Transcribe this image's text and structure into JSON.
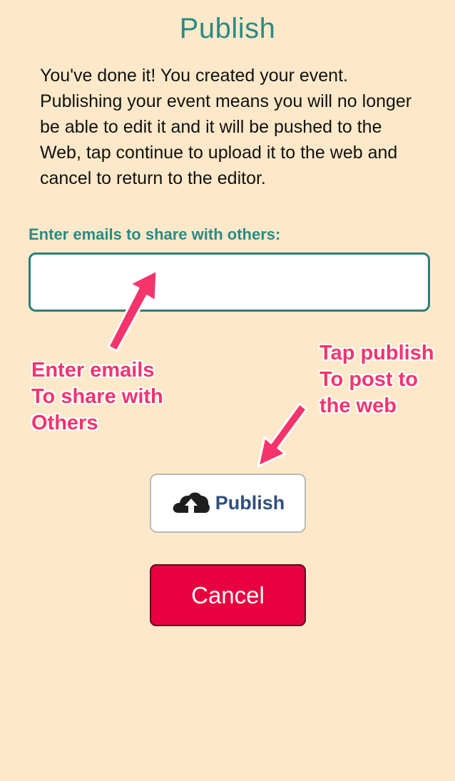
{
  "dialog": {
    "title": "Publish",
    "description": "You've done it! You created your event. Publishing your event means you will no longer be able to edit it and it will be pushed to the Web, tap continue to upload it to the web and cancel to return to the editor."
  },
  "email_share": {
    "label": "Enter emails to share with others:",
    "value": "",
    "placeholder": ""
  },
  "annotations": {
    "email_hint": [
      "Enter emails",
      "To share with",
      "Others"
    ],
    "publish_hint": [
      "Tap publish",
      "To post to",
      "the web"
    ]
  },
  "buttons": {
    "publish_label": "Publish",
    "publish_icon": "cloud-upload-icon",
    "cancel_label": "Cancel"
  },
  "colors": {
    "background": "#fde9c9",
    "accent_teal": "#2b8a86",
    "annotation_pink": "#f5346c",
    "cancel_red": "#e8003f",
    "publish_text": "#2f4f7a"
  }
}
